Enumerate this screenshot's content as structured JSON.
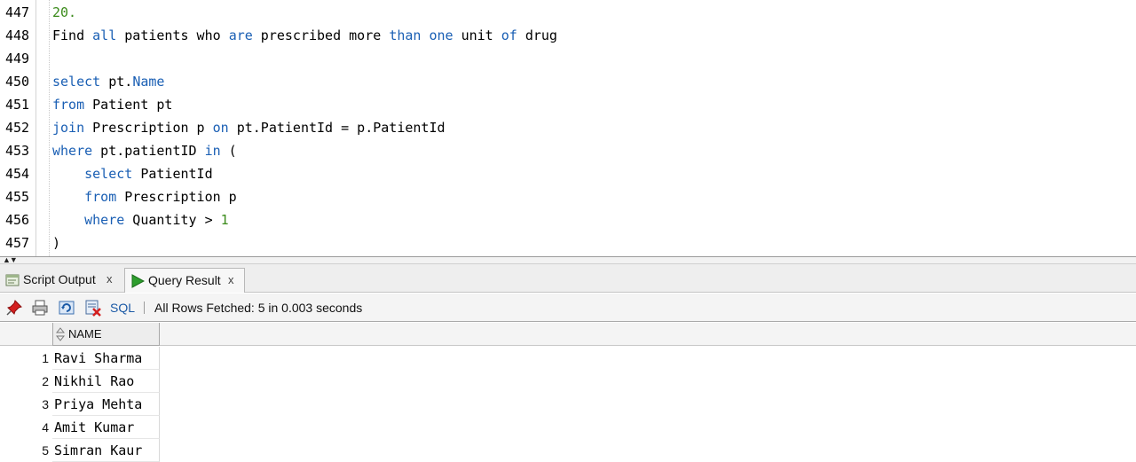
{
  "editor": {
    "lines": [
      {
        "num": "447",
        "tokens": [
          {
            "t": "20.",
            "c": "num"
          }
        ]
      },
      {
        "num": "448",
        "tokens": [
          {
            "t": "Find ",
            "c": "plain"
          },
          {
            "t": "all",
            "c": "kw"
          },
          {
            "t": " patients who ",
            "c": "plain"
          },
          {
            "t": "are",
            "c": "kw"
          },
          {
            "t": " prescribed more ",
            "c": "plain"
          },
          {
            "t": "than",
            "c": "kw"
          },
          {
            "t": " ",
            "c": "plain"
          },
          {
            "t": "one",
            "c": "kw"
          },
          {
            "t": " unit ",
            "c": "plain"
          },
          {
            "t": "of",
            "c": "kw"
          },
          {
            "t": " drug",
            "c": "plain"
          }
        ]
      },
      {
        "num": "449",
        "tokens": []
      },
      {
        "num": "450",
        "tokens": [
          {
            "t": "select",
            "c": "kw"
          },
          {
            "t": " pt.",
            "c": "plain"
          },
          {
            "t": "Name",
            "c": "kw"
          }
        ]
      },
      {
        "num": "451",
        "tokens": [
          {
            "t": "from",
            "c": "kw"
          },
          {
            "t": " Patient pt",
            "c": "plain"
          }
        ]
      },
      {
        "num": "452",
        "tokens": [
          {
            "t": "join",
            "c": "kw"
          },
          {
            "t": " Prescription p ",
            "c": "plain"
          },
          {
            "t": "on",
            "c": "kw"
          },
          {
            "t": " pt.PatientId = p.PatientId",
            "c": "plain"
          }
        ]
      },
      {
        "num": "453",
        "tokens": [
          {
            "t": "where",
            "c": "kw"
          },
          {
            "t": " pt.patientID ",
            "c": "plain"
          },
          {
            "t": "in",
            "c": "kw"
          },
          {
            "t": " (",
            "c": "plain"
          }
        ]
      },
      {
        "num": "454",
        "tokens": [
          {
            "t": "    ",
            "c": "plain"
          },
          {
            "t": "select",
            "c": "kw"
          },
          {
            "t": " PatientId",
            "c": "plain"
          }
        ]
      },
      {
        "num": "455",
        "tokens": [
          {
            "t": "    ",
            "c": "plain"
          },
          {
            "t": "from",
            "c": "kw"
          },
          {
            "t": " Prescription p",
            "c": "plain"
          }
        ]
      },
      {
        "num": "456",
        "tokens": [
          {
            "t": "    ",
            "c": "plain"
          },
          {
            "t": "where",
            "c": "kw"
          },
          {
            "t": " Quantity > ",
            "c": "plain"
          },
          {
            "t": "1",
            "c": "num"
          }
        ]
      },
      {
        "num": "457",
        "tokens": [
          {
            "t": ")",
            "c": "plain"
          }
        ]
      }
    ]
  },
  "tabs": {
    "script_output": {
      "label": "Script Output",
      "close": "x",
      "icon": "script-output-icon"
    },
    "query_result": {
      "label": "Query Result",
      "close": "x",
      "icon": "run-triangle-icon"
    }
  },
  "toolbar": {
    "sql_label": "SQL",
    "status": "All Rows Fetched: 5 in 0.003 seconds",
    "icons": [
      "pin-icon",
      "print-icon",
      "refresh-icon",
      "delete-icon"
    ]
  },
  "grid": {
    "columns": [
      "NAME"
    ],
    "rows": [
      {
        "num": "1",
        "name": "Ravi Sharma"
      },
      {
        "num": "2",
        "name": "Nikhil Rao"
      },
      {
        "num": "3",
        "name": "Priya Mehta"
      },
      {
        "num": "4",
        "name": "Amit Kumar"
      },
      {
        "num": "5",
        "name": "Simran Kaur"
      }
    ]
  },
  "colors": {
    "keyword": "#1a5fb4",
    "number": "#3b8b1b",
    "link": "#1c5aa6",
    "run_green": "#2e9e2e"
  }
}
